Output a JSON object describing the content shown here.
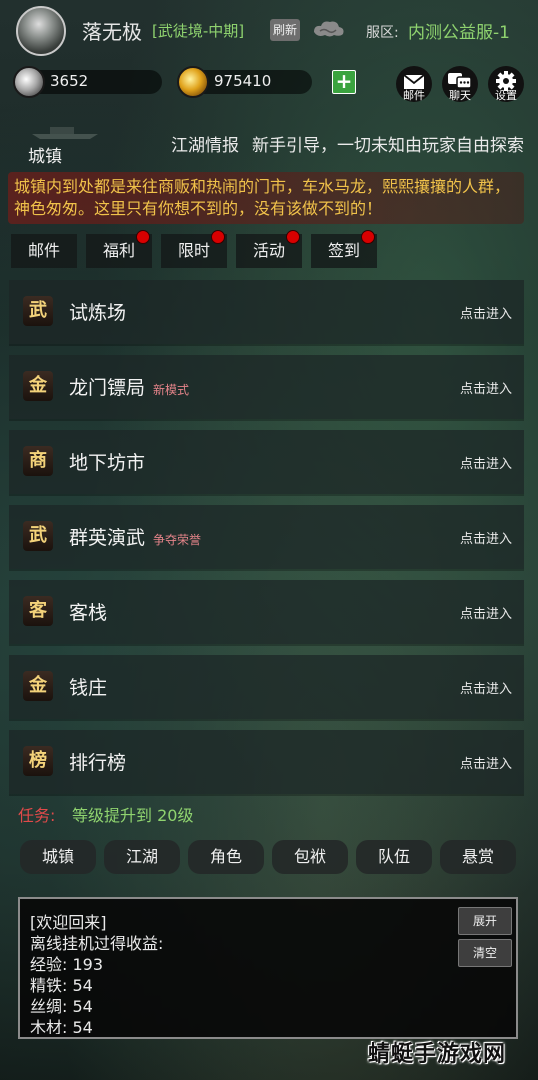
{
  "header": {
    "player_name": "落无极",
    "player_rank": "[武徒境-中期]",
    "refresh_label": "刷新",
    "server_label": "服区:",
    "server_name": "内测公益服-1"
  },
  "currency": {
    "silver": "3652",
    "gold": "975410"
  },
  "top_buttons": [
    {
      "label": "邮件",
      "icon": "mail-icon"
    },
    {
      "label": "聊天",
      "icon": "chat-icon"
    },
    {
      "label": "设置",
      "icon": "gear-icon"
    }
  ],
  "town": {
    "title": "城镇",
    "news_label": "江湖情报",
    "news_text": "新手引导，一切未知由玩家自由探索",
    "description": "城镇内到处都是来往商贩和热闹的门市，车水马龙，熙熙攘攘的人群，神色匆匆。这里只有你想不到的，没有该做不到的！"
  },
  "tabs": [
    {
      "label": "邮件",
      "dot": false
    },
    {
      "label": "福利",
      "dot": true
    },
    {
      "label": "限时",
      "dot": true
    },
    {
      "label": "活动",
      "dot": true
    },
    {
      "label": "签到",
      "dot": true
    }
  ],
  "locations": [
    {
      "icon": "武",
      "name": "试炼场",
      "tag": "",
      "action": "点击进入"
    },
    {
      "icon": "金",
      "name": "龙门镖局",
      "tag": "新模式",
      "action": "点击进入"
    },
    {
      "icon": "商",
      "name": "地下坊市",
      "tag": "",
      "action": "点击进入"
    },
    {
      "icon": "武",
      "name": "群英演武",
      "tag": "争夺荣誉",
      "action": "点击进入"
    },
    {
      "icon": "客",
      "name": "客栈",
      "tag": "",
      "action": "点击进入"
    },
    {
      "icon": "金",
      "name": "钱庄",
      "tag": "",
      "action": "点击进入"
    },
    {
      "icon": "榜",
      "name": "排行榜",
      "tag": "",
      "action": "点击进入"
    }
  ],
  "task": {
    "label": "任务:",
    "text": "等级提升到 20级"
  },
  "bottom_nav": [
    "城镇",
    "江湖",
    "角色",
    "包袱",
    "队伍",
    "悬赏"
  ],
  "log": {
    "lines": [
      "[欢迎回来]",
      "离线挂机过得收益:",
      "经验: 193",
      "精铁: 54",
      "丝绸: 54",
      "木材: 54"
    ],
    "expand_label": "展开",
    "clear_label": "清空"
  },
  "watermark": "蜻蜓手游戏网",
  "colors": {
    "green": "#8fd36f",
    "gold": "#f0c24a",
    "red": "#e04a4a"
  }
}
